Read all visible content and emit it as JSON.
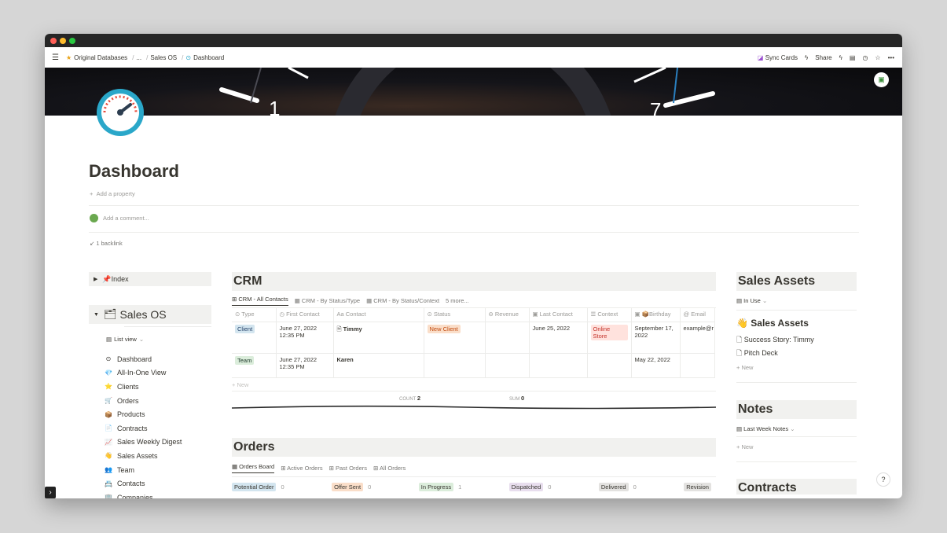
{
  "breadcrumb": [
    "Original Databases",
    "...",
    "Sales OS",
    "Dashboard"
  ],
  "topbar": {
    "sync": "Sync Cards",
    "share": "Share"
  },
  "page": {
    "title": "Dashboard",
    "add_property": "Add a property",
    "add_comment": "Add a comment...",
    "backlink": "1 backlink"
  },
  "sidebar": {
    "index": "📌Index",
    "title": "Sales OS",
    "view": "List view",
    "items": [
      {
        "icon": "⊙",
        "label": "Dashboard"
      },
      {
        "icon": "💎",
        "label": "All-In-One View"
      },
      {
        "icon": "⭐",
        "label": "Clients"
      },
      {
        "icon": "🛒",
        "label": "Orders"
      },
      {
        "icon": "📦",
        "label": "Products"
      },
      {
        "icon": "📄",
        "label": "Contracts"
      },
      {
        "icon": "📈",
        "label": "Sales Weekly Digest"
      },
      {
        "icon": "👋",
        "label": "Sales Assets"
      },
      {
        "icon": "👥",
        "label": "Team"
      },
      {
        "icon": "📇",
        "label": "Contacts"
      },
      {
        "icon": "🏢",
        "label": "Companies"
      }
    ]
  },
  "crm": {
    "title": "CRM",
    "tabs": [
      "CRM - All Contacts",
      "CRM - By Status/Type",
      "CRM - By Status/Context",
      "5 more..."
    ],
    "columns": [
      "Type",
      "First Contact",
      "Contact",
      "Status",
      "Revenue",
      "Last Contact",
      "Context",
      "📦Birthday",
      "Email"
    ],
    "rows": [
      {
        "type": "Client",
        "first": "June 27, 2022 12:35 PM",
        "contact": "Timmy",
        "status": "New Client",
        "revenue": "",
        "last": "June 25, 2022",
        "context": "Online Store",
        "birthday": "September 17, 2022",
        "email": "example@r"
      },
      {
        "type": "Team",
        "first": "June 27, 2022 12:35 PM",
        "contact": "Karen",
        "status": "",
        "revenue": "",
        "last": "",
        "context": "",
        "birthday": "May 22, 2022",
        "email": ""
      }
    ],
    "new": "+ New",
    "count_label": "COUNT",
    "count": "2",
    "sum_label": "SUM",
    "sum": "0"
  },
  "orders": {
    "title": "Orders",
    "tabs": [
      "Orders Board",
      "Active Orders",
      "Past Orders",
      "All Orders"
    ],
    "columns": [
      {
        "label": "Potential Order",
        "count": "0",
        "color": "#d3e5ef"
      },
      {
        "label": "Offer Sent",
        "count": "0",
        "color": "#fadec9"
      },
      {
        "label": "In Progress",
        "count": "1",
        "color": "#dbeddb"
      },
      {
        "label": "Dispatched",
        "count": "0",
        "color": "#e8deee"
      },
      {
        "label": "Delivered",
        "count": "0",
        "color": "#e3e2e0"
      },
      {
        "label": "Revision",
        "count": "",
        "color": "#e3e2e0"
      }
    ]
  },
  "assets": {
    "title": "Sales Assets",
    "view": "In Use",
    "subtitle": "Sales Assets",
    "items": [
      "Success Story: Timmy",
      "Pitch Deck"
    ],
    "new": "+ New"
  },
  "notes": {
    "title": "Notes",
    "view": "Last Week Notes",
    "new": "+ New"
  },
  "contracts": {
    "title": "Contracts"
  }
}
